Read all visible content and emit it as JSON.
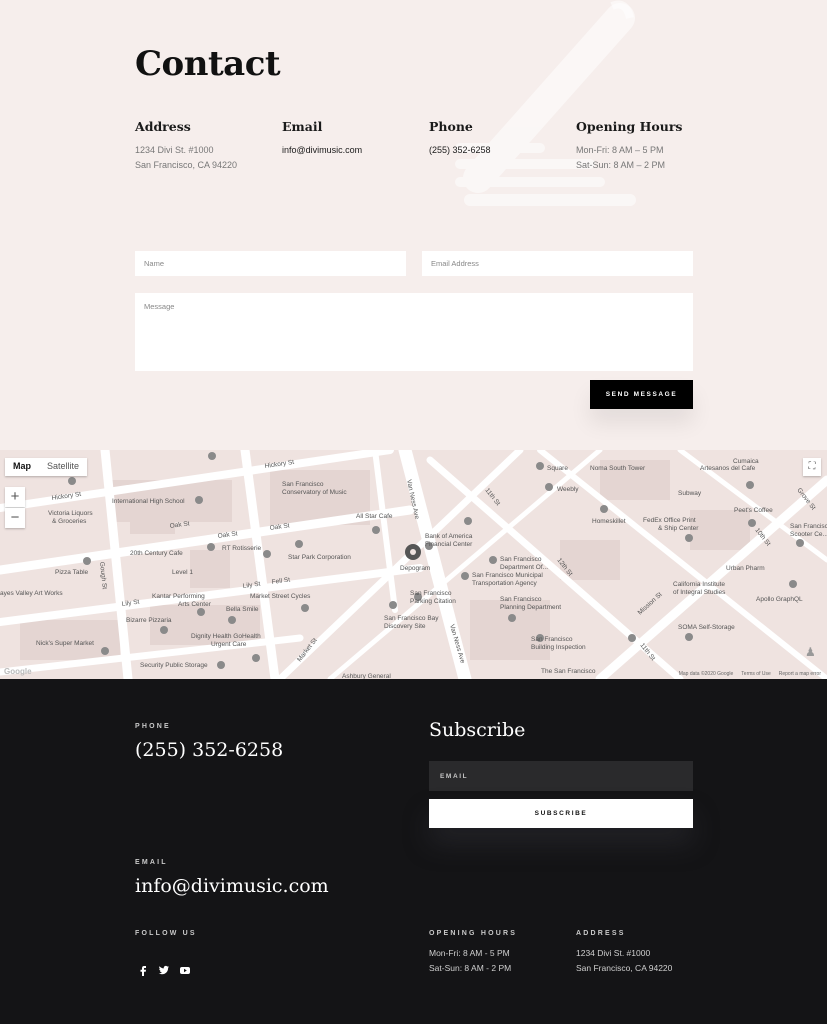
{
  "contact": {
    "title": "Contact",
    "address": {
      "heading": "Address",
      "line1": "1234 Divi St. #1000",
      "line2": "San Francisco, CA 94220"
    },
    "email": {
      "heading": "Email",
      "value": "info@divimusic.com"
    },
    "phone": {
      "heading": "Phone",
      "value": "(255) 352-6258"
    },
    "hours": {
      "heading": "Opening Hours",
      "line1": "Mon-Fri: 8 AM – 5 PM",
      "line2": "Sat-Sun: 8 AM – 2 PM"
    },
    "form": {
      "name_placeholder": "Name",
      "email_placeholder": "Email Address",
      "message_placeholder": "Message",
      "send_label": "SEND MESSAGE"
    }
  },
  "map": {
    "type_map": "Map",
    "type_satellite": "Satellite",
    "zoom_in": "+",
    "zoom_out": "−",
    "streets": [
      "Hickory St",
      "Oak St",
      "Lily St",
      "Fell St",
      "Gough St",
      "Van Ness Ave",
      "Market St",
      "Mission St",
      "10th St",
      "11th St",
      "12th St",
      "Grove St"
    ],
    "places": [
      "International High School",
      "San Francisco Conservatory of Music",
      "Victoria Liquors & Groceries",
      "20th Century Cafe",
      "RT Rotisserie",
      "Star Park Corporation",
      "All Star Cafe",
      "Bank of America Financial Center",
      "San Francisco Department Of...",
      "San Francisco Municipal Transportation Agency",
      "San Francisco Parking Citation",
      "San Francisco Planning Department",
      "San Francisco Bay Discovery Site",
      "San Francisco Building Inspection",
      "Kantar Performing Arts Center",
      "Bella Smile",
      "Market Street Cycles",
      "Dignity Health GoHealth Urgent Care",
      "Security Public Storage",
      "Nick's Super Market",
      "Pizza Table",
      "Hayes Valley Art Works",
      "Level 1",
      "Depogram",
      "Square",
      "Weebly",
      "Noma South Tower",
      "Cumaica",
      "Artesanos del Cafe",
      "Subway",
      "Homeskillet",
      "FedEx Office Print & Ship Center",
      "Peet's Coffee",
      "California Institute of Integral Studies",
      "Urban Pharm",
      "Apollo GraphQL",
      "SOMA Self-Storage",
      "San Francisco Scooter Ce...",
      "Bizarre Pizzaria",
      "The San Francisco",
      "Ashbury General"
    ],
    "footer_data": "Map data ©2020 Google",
    "footer_terms": "Terms of Use",
    "footer_report": "Report a map error",
    "google": "Google"
  },
  "footer": {
    "phone_label": "PHONE",
    "phone_value": "(255) 352-6258",
    "subscribe_title": "Subscribe",
    "email_placeholder": "EMAIL",
    "subscribe_label": "SUBSCRIBE",
    "email_label": "EMAIL",
    "email_value": "info@divimusic.com",
    "follow_label": "FOLLOW US",
    "hours_label": "OPENING HOURS",
    "hours_line1": "Mon-Fri: 8 AM - 5 PM",
    "hours_line2": "Sat-Sun: 8 AM - 2 PM",
    "address_label": "ADDRESS",
    "address_line1": "1234 Divi St. #1000",
    "address_line2": "San Francisco, CA 94220",
    "social_icons": [
      "facebook-icon",
      "twitter-icon",
      "youtube-icon"
    ]
  },
  "colors": {
    "contact_bg": "#f6eeec",
    "footer_bg": "#141416",
    "accent": "#000000"
  }
}
